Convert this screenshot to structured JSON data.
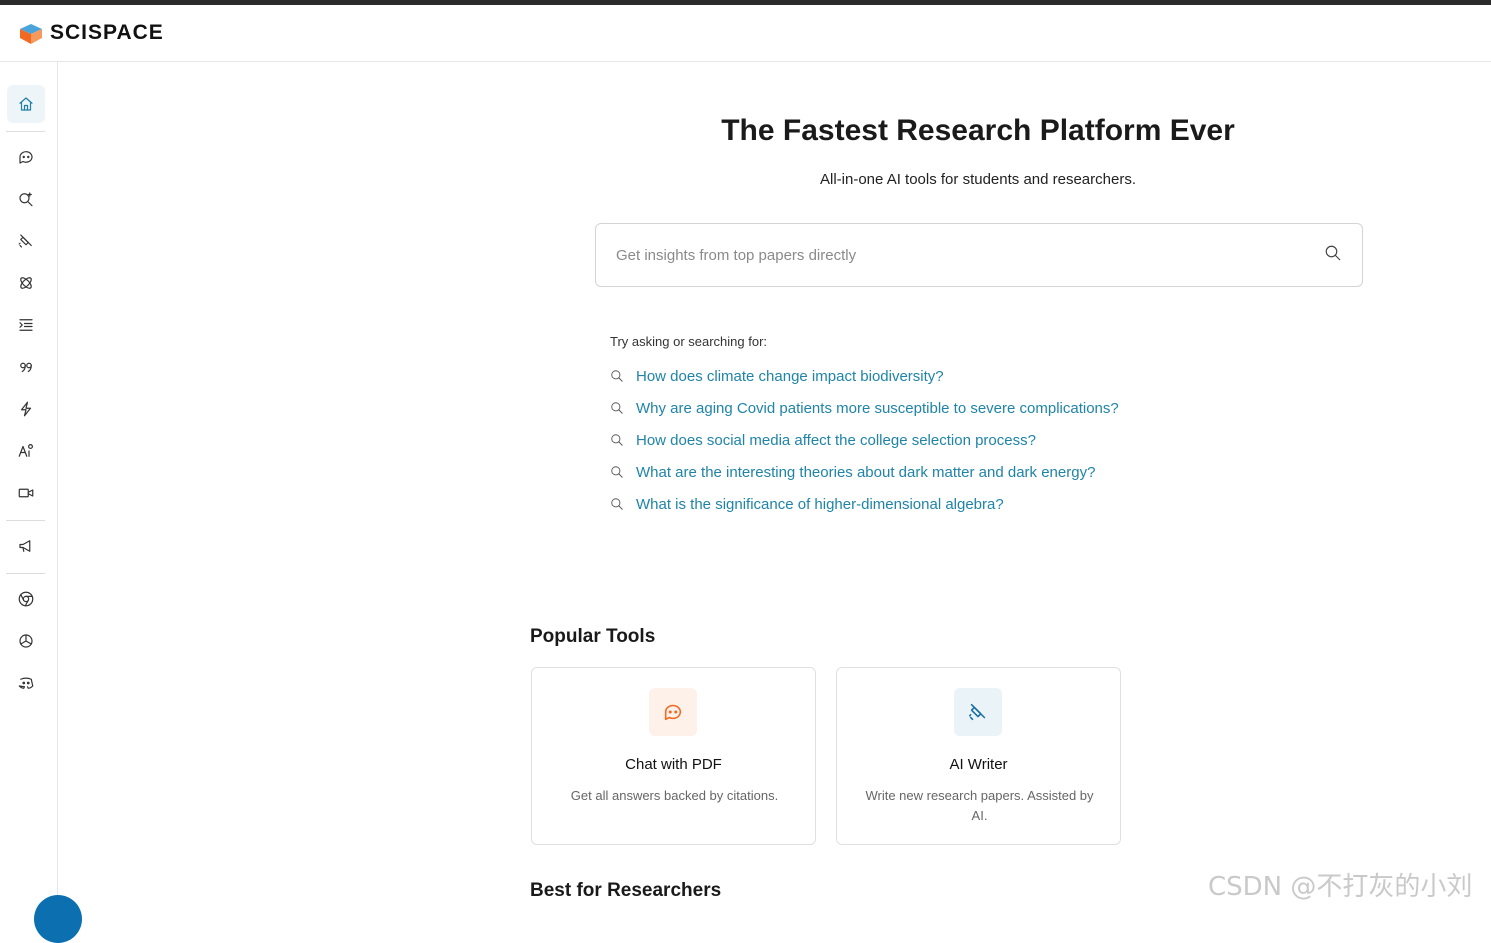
{
  "brand": {
    "name": "SCISPACE"
  },
  "sidebar": {
    "items": [
      {
        "icon": "home-icon",
        "active": true
      },
      {
        "icon": "chat-pdf-icon"
      },
      {
        "icon": "literature-search-icon"
      },
      {
        "icon": "ai-writer-icon"
      },
      {
        "icon": "extract-data-icon"
      },
      {
        "icon": "paraphraser-icon"
      },
      {
        "icon": "citation-generator-icon"
      },
      {
        "icon": "ai-detector-icon"
      },
      {
        "icon": "pdf-to-video-icon"
      },
      {
        "icon": "video-icon"
      },
      {
        "icon": "announcement-icon"
      },
      {
        "icon": "chrome-extension-icon"
      },
      {
        "icon": "chatgpt-plugin-icon"
      },
      {
        "icon": "discord-icon"
      }
    ]
  },
  "hero": {
    "title": "The Fastest Research Platform Ever",
    "subtitle": "All-in-one AI tools for students and researchers."
  },
  "search": {
    "placeholder": "Get insights from top papers directly"
  },
  "suggestions": {
    "label": "Try asking or searching for:",
    "items": [
      "How does climate change impact biodiversity?",
      "Why are aging Covid patients more susceptible to severe complications?",
      "How does social media affect the college selection process?",
      "What are the interesting theories about dark matter and dark energy?",
      "What is the significance of higher-dimensional algebra?"
    ]
  },
  "popular_tools": {
    "title": "Popular Tools",
    "tools": [
      {
        "name": "Chat with PDF",
        "description": "Get all answers backed by citations.",
        "icon": "chat-pdf-icon",
        "accent": "#f26a21",
        "icon_bg": "#fdf1ea"
      },
      {
        "name": "AI Writer",
        "description": "Write new research papers. Assisted by AI.",
        "icon": "ai-writer-icon",
        "accent": "#1a6fa3",
        "icon_bg": "#eaf3f8"
      }
    ]
  },
  "best_for_researchers": {
    "title": "Best for Researchers"
  },
  "watermark": "CSDN @不打灰的小刘",
  "colors": {
    "link": "#1f84a8",
    "active_bg": "#eef5f8",
    "brand_orange": "#f26a21",
    "brand_blue": "#1a6fa3"
  }
}
